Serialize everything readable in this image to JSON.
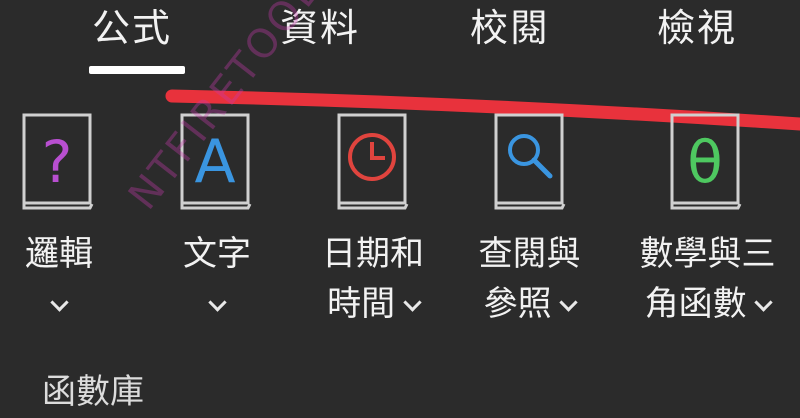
{
  "tabs": [
    {
      "label": "公式"
    },
    {
      "label": "資料"
    },
    {
      "label": "校閱"
    },
    {
      "label": "檢視"
    }
  ],
  "active_tab": "公式",
  "ribbon": {
    "buttons": [
      {
        "line1": "邏輯",
        "line2": "",
        "icon": "logical-book-icon",
        "icon_color": "#b84fd0",
        "glyph": "?"
      },
      {
        "line1": "文字",
        "line2": "",
        "icon": "text-book-icon",
        "icon_color": "#3a95e0",
        "glyph": "A"
      },
      {
        "line1": "日期和",
        "line2": "時間",
        "icon": "date-time-book-icon",
        "icon_color": "#e0443e",
        "glyph": "clock"
      },
      {
        "line1": "查閱與",
        "line2": "參照",
        "icon": "lookup-reference-book-icon",
        "icon_color": "#3a95e0",
        "glyph": "magnifier"
      },
      {
        "line1": "數學與三",
        "line2": "角函數",
        "icon": "math-trig-book-icon",
        "icon_color": "#4ec860",
        "glyph": "θ"
      }
    ],
    "group_label": "函數庫"
  },
  "watermark": "NTFIRETOOLBOX.AP",
  "colors": {
    "background": "#2b2b2b",
    "annotation_stroke": "#e8323c",
    "book_outline": "#d0d0d0"
  }
}
